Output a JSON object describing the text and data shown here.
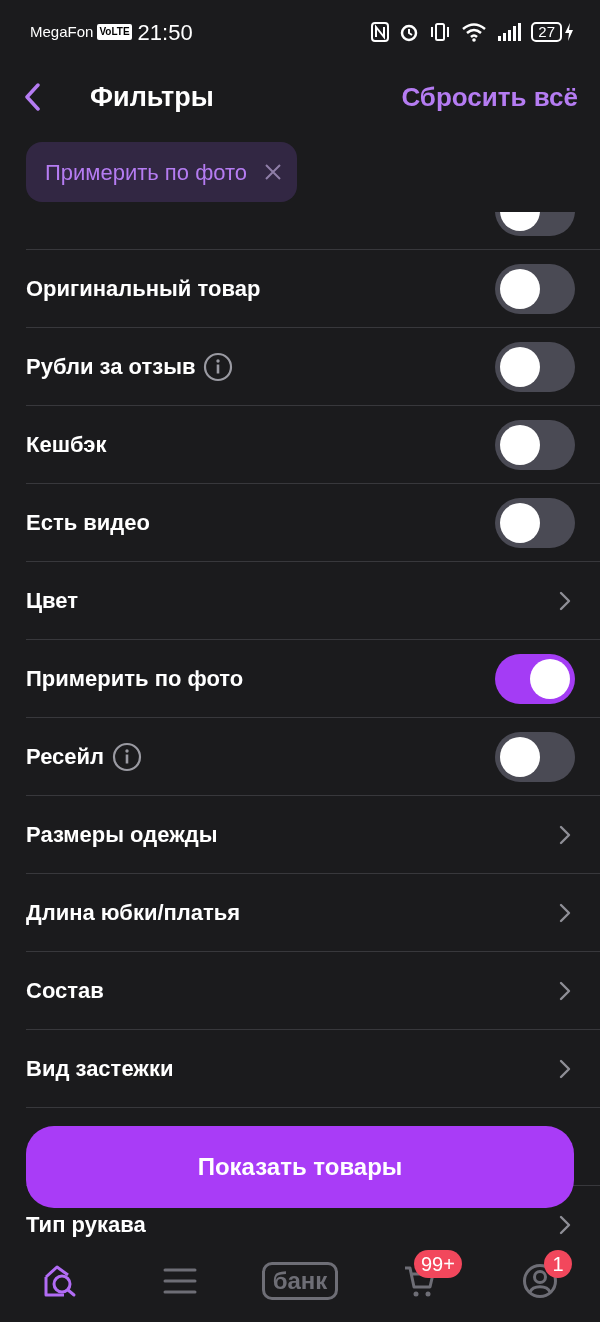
{
  "status_bar": {
    "carrier": "MegaFon",
    "volte": "VoLTE",
    "time": "21:50",
    "battery": "27"
  },
  "header": {
    "title": "Фильтры",
    "reset": "Сбросить всё"
  },
  "chips": [
    {
      "label": "Примерить по фото"
    }
  ],
  "filters": [
    {
      "kind": "toggle",
      "on": false
    },
    {
      "kind": "toggle",
      "label": "Оригинальный товар",
      "on": false
    },
    {
      "kind": "toggle",
      "label": "Рубли за отзыв",
      "info": true,
      "on": false
    },
    {
      "kind": "toggle",
      "label": "Кешбэк",
      "on": false
    },
    {
      "kind": "toggle",
      "label": "Есть видео",
      "on": false
    },
    {
      "kind": "link",
      "label": "Цвет"
    },
    {
      "kind": "toggle",
      "label": "Примерить по фото",
      "on": true
    },
    {
      "kind": "toggle",
      "label": "Ресейл",
      "info": true,
      "on": false
    },
    {
      "kind": "link",
      "label": "Размеры одежды"
    },
    {
      "kind": "link",
      "label": "Длина юбки/платья"
    },
    {
      "kind": "link",
      "label": "Состав"
    },
    {
      "kind": "link",
      "label": "Вид застежки"
    },
    {
      "kind": "covered"
    },
    {
      "kind": "link",
      "label": "Тип рукава"
    }
  ],
  "show_button": "Показать товары",
  "nav": [
    {
      "kind": "home",
      "selected": true
    },
    {
      "kind": "catalog",
      "selected": false
    },
    {
      "kind": "bank",
      "label": "банк",
      "selected": false
    },
    {
      "kind": "cart",
      "badge": "99+",
      "selected": false
    },
    {
      "kind": "profile",
      "badge": "1",
      "selected": false
    }
  ]
}
